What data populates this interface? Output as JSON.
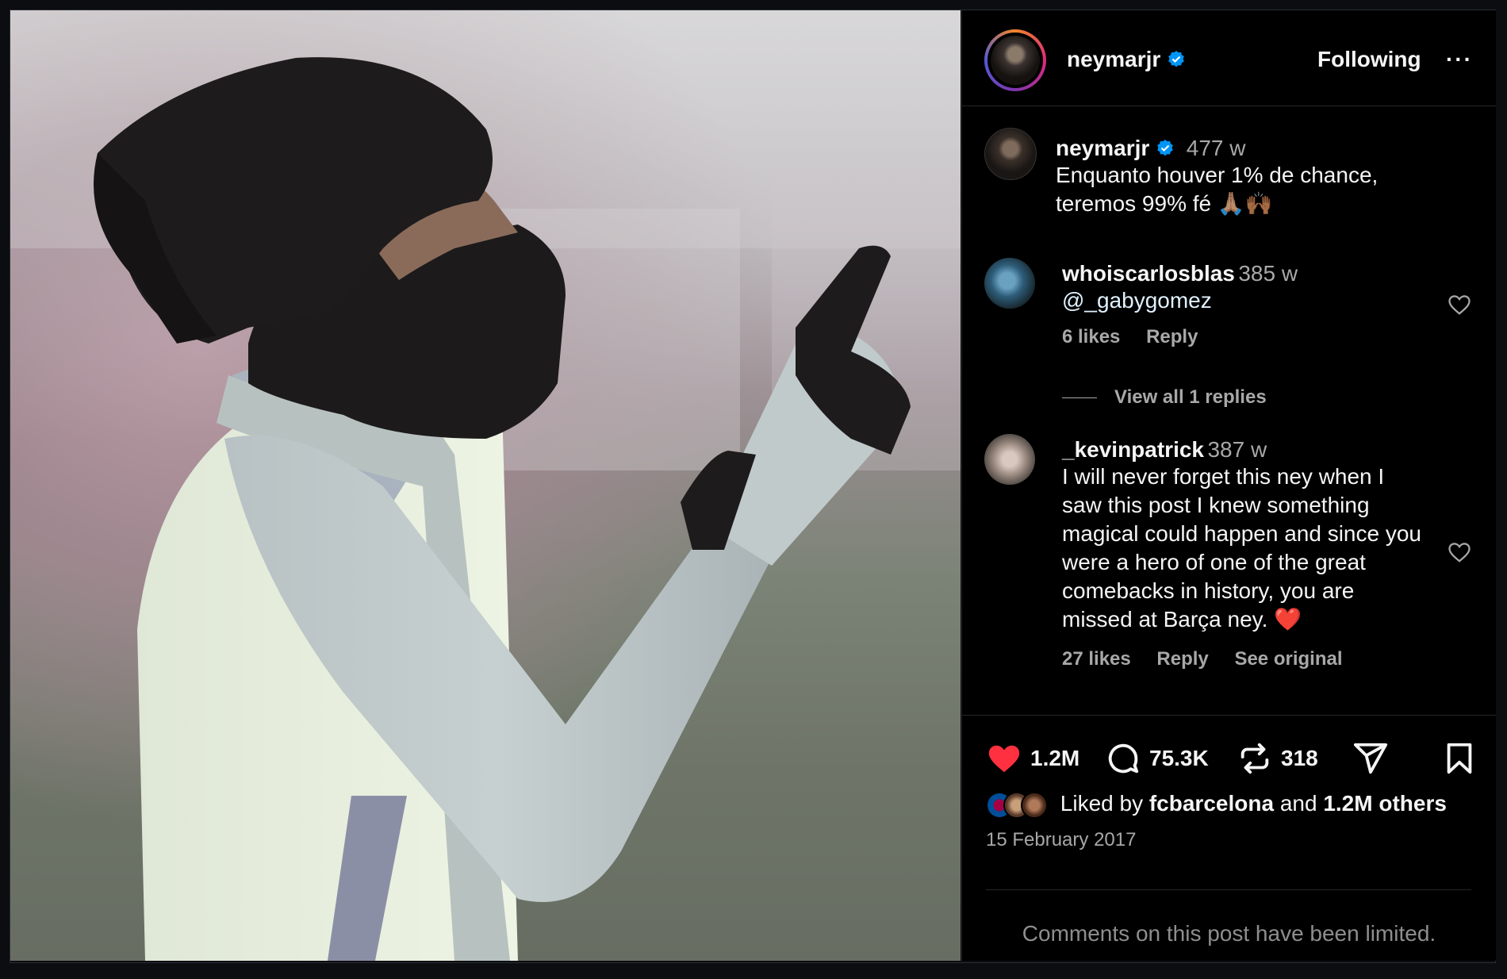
{
  "post": {
    "username": "neymarjr",
    "follow_status": "Following",
    "more_label": "···",
    "caption": {
      "username": "neymarjr",
      "age": "477 w",
      "text_line1": "Enquanto houver 1% de chance,",
      "text_line2": "teremos 99% fé 🙏🏽🙌🏾"
    }
  },
  "comments": [
    {
      "username": "whoiscarlosblas",
      "age": "385 w",
      "text": "@_gabygomez",
      "likes": "6 likes",
      "reply": "Reply",
      "view_replies": "View all 1 replies"
    },
    {
      "username": "_kevinpatrick",
      "age": "387 w",
      "lines": [
        "I will never forget this ney when I",
        "saw this post I knew something",
        "magical could happen and since you",
        "were a hero of one of the great",
        "comebacks in history, you are",
        "missed at Barça ney. ❤️"
      ],
      "likes": "27 likes",
      "reply": "Reply",
      "see_original": "See original"
    }
  ],
  "stats": {
    "likes": "1.2M",
    "comments": "75.3K",
    "reposts": "318"
  },
  "liked_by": {
    "prefix": "Liked by",
    "user": "fcbarcelona",
    "and": "and",
    "others": "1.2M others"
  },
  "date": "15 February 2017",
  "limited_notice": "Comments on this post have been limited.",
  "colors": {
    "background": "#000000",
    "heart_red": "#ff3040",
    "verified_blue": "#0095f6",
    "muted_text": "#a8a8a8"
  },
  "icons": [
    "verified-badge-icon",
    "more-options-icon",
    "heart-icon",
    "comment-icon",
    "repost-icon",
    "share-icon",
    "bookmark-icon"
  ]
}
